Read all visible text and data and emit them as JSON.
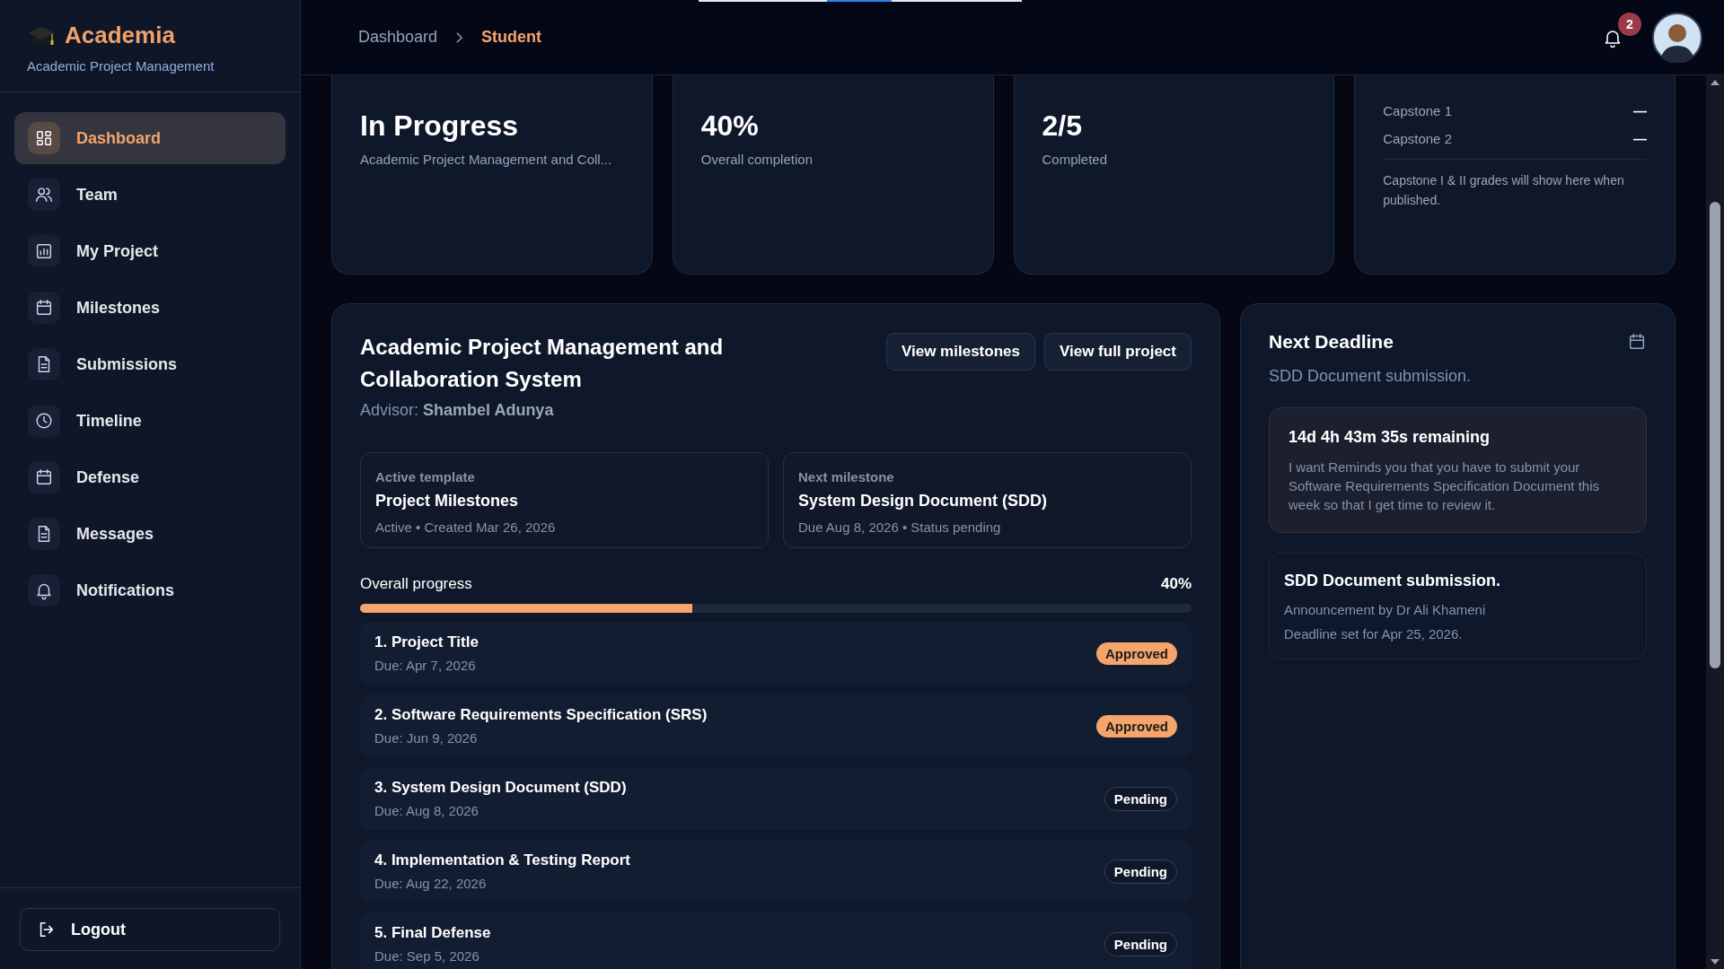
{
  "sidebar": {
    "brand": "Academia",
    "subtitle": "Academic Project Management",
    "items": [
      {
        "label": "Dashboard",
        "selected": true
      },
      {
        "label": "Team",
        "selected": false
      },
      {
        "label": "My Project",
        "selected": false
      },
      {
        "label": "Milestones",
        "selected": false
      },
      {
        "label": "Submissions",
        "selected": false
      },
      {
        "label": "Timeline",
        "selected": false
      },
      {
        "label": "Defense",
        "selected": false
      },
      {
        "label": "Messages",
        "selected": false
      },
      {
        "label": "Notifications",
        "selected": false
      }
    ],
    "logout": "Logout"
  },
  "topbar": {
    "breadcrumb": [
      "Dashboard",
      "Student"
    ],
    "notification_count": "2"
  },
  "stats": [
    {
      "kind": "stat",
      "value": "In Progress",
      "caption": "Academic Project Management and Coll..."
    },
    {
      "kind": "stat",
      "value": "40%",
      "caption": "Overall completion"
    },
    {
      "kind": "stat",
      "value": "2/5",
      "caption": "Completed"
    },
    {
      "kind": "grades",
      "rows": [
        {
          "label": "Capstone 1",
          "value": "—"
        },
        {
          "label": "Capstone 2",
          "value": "—"
        }
      ],
      "note": "Capstone I & II grades will show here when published."
    }
  ],
  "project": {
    "title": "Academic Project Management and Collaboration System",
    "advisor_label": "Advisor:",
    "advisor": "Shambel Adunya",
    "buttons": [
      "View milestones",
      "View full project"
    ],
    "info": [
      {
        "label": "Active template",
        "title": "Project Milestones",
        "meta": "Active • Created Mar 26, 2026"
      },
      {
        "label": "Next milestone",
        "title": "System Design Document (SDD)",
        "meta": "Due Aug 8, 2026 • Status pending"
      }
    ],
    "progress": {
      "label": "Overall progress",
      "reading": "40%",
      "level": 0.4
    },
    "milestones": [
      {
        "title": "1. Project Title",
        "due": "Due: Apr 7, 2026",
        "status": "Approved",
        "kind": "approved"
      },
      {
        "title": "2. Software Requirements Specification (SRS)",
        "due": "Due: Jun 9, 2026",
        "status": "Approved",
        "kind": "approved"
      },
      {
        "title": "3. System Design Document (SDD)",
        "due": "Due: Aug 8, 2026",
        "status": "Pending",
        "kind": "pending"
      },
      {
        "title": "4. Implementation & Testing Report",
        "due": "Due: Aug 22, 2026",
        "status": "Pending",
        "kind": "pending"
      },
      {
        "title": "5. Final Defense",
        "due": "Due: Sep 5, 2026",
        "status": "Pending",
        "kind": "pending"
      }
    ]
  },
  "deadline": {
    "title": "Next Deadline",
    "subtitle": "SDD Document submission.",
    "countdown": {
      "title": "14d 4h 43m 35s remaining",
      "text": "I want Reminds you that you have to submit your Software Requirements Specification Document this week so that I get time to review it."
    },
    "announcement": {
      "title": "SDD Document submission.",
      "by": "Announcement by Dr Ali Khameni",
      "date": "Deadline set for Apr 25, 2026."
    }
  }
}
